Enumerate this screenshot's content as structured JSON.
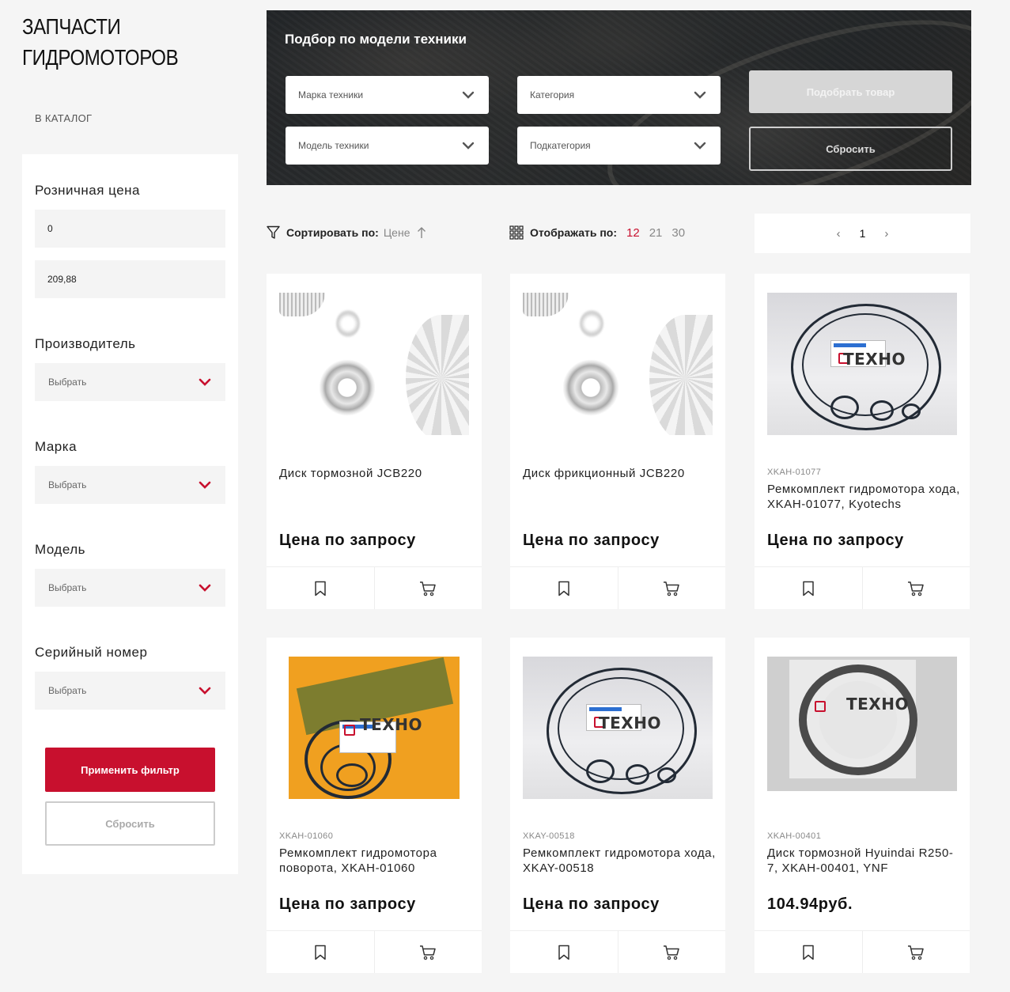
{
  "page": {
    "title_line1": "ЗАПЧАСТИ",
    "title_line2": "ГИДРОМОТОРОВ",
    "catalog_link": "В КАТАЛОГ"
  },
  "filters": {
    "price_label": "Розничная цена",
    "price_min": "0",
    "price_max": "209,88",
    "manufacturer_label": "Производитель",
    "manufacturer_value": "Выбрать",
    "brand_label": "Марка",
    "brand_value": "Выбрать",
    "model_label": "Модель",
    "model_value": "Выбрать",
    "serial_label": "Серийный номер",
    "serial_value": "Выбрать",
    "apply_label": "Применить фильтр",
    "reset_label": "Сбросить"
  },
  "banner": {
    "title": "Подбор по модели техники",
    "brand_placeholder": "Марка техники",
    "category_placeholder": "Категория",
    "model_placeholder": "Модель техники",
    "subcategory_placeholder": "Подкатегория",
    "pick_label": "Подобрать товар",
    "reset_label": "Сбросить"
  },
  "toolbar": {
    "sort_label": "Сортировать по:",
    "sort_value": "Цене",
    "show_label": "Отображать по:",
    "show_options": [
      "12",
      "21",
      "30"
    ],
    "show_active": "12",
    "page_current": "1",
    "prev_icon": "‹",
    "next_icon": "›"
  },
  "products": [
    {
      "sku": "",
      "name": "Диск тормозной JCB220",
      "price": "Цена по запросу",
      "image": "parts"
    },
    {
      "sku": "",
      "name": "Диск фрикционный JCB220",
      "price": "Цена по запросу",
      "image": "parts"
    },
    {
      "sku": "XKAH-01077",
      "name": "Ремкомплект гидромотора хода, XKAH-01077, Kyotechs",
      "price": "Цена по запросу",
      "image": "kit"
    },
    {
      "sku": "XKAH-01060",
      "name": "Ремкомплект гидромотора поворота, XKAH-01060",
      "price": "Цена по запросу",
      "image": "kit-yellow"
    },
    {
      "sku": "XKAY-00518",
      "name": "Ремкомплект гидромотора хода, XKAY-00518",
      "price": "Цена по запросу",
      "image": "kit"
    },
    {
      "sku": "XKAH-00401",
      "name": "Диск тормозной Hyuindai R250-7, XKAH-00401, YNF",
      "price": "104.94руб.",
      "image": "disc"
    }
  ],
  "watermark": "ТЕХНО",
  "colors": {
    "accent": "#c8102e",
    "background": "#f5f5f5",
    "card": "#ffffff"
  },
  "icons": {
    "sort": "filter-icon",
    "sort_dir": "arrow-up-icon",
    "grid": "grid-icon",
    "select": "chevron-down-icon",
    "bookmark": "bookmark-icon",
    "cart": "cart-icon"
  }
}
